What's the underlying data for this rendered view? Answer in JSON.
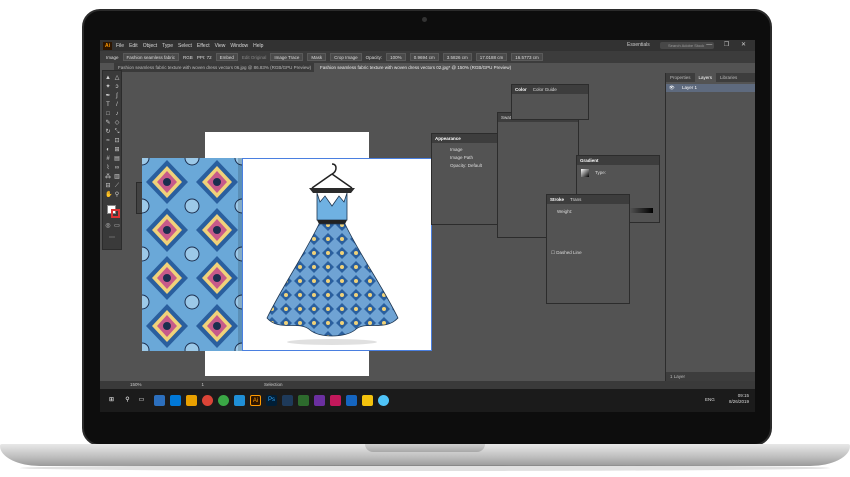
{
  "app": {
    "logo": "Ai",
    "menu": [
      "File",
      "Edit",
      "Object",
      "Type",
      "Select",
      "Effect",
      "View",
      "Window",
      "Help"
    ],
    "workspace": "Essentials",
    "search_placeholder": "Search Adobe Stock",
    "window_controls": "— ❐ ✕"
  },
  "control_bar": {
    "selection_type": "Image",
    "filename": "Fashion seamless fabric",
    "color_mode": "RGB",
    "ppi": "PPI: 72",
    "embed": "Embed",
    "edit_original": "Edit Original",
    "image_trace": "Image Trace",
    "mask": "Mask",
    "crop_image": "Crop Image",
    "opacity_label": "Opacity:",
    "opacity_value": "100%",
    "x": "0.9694 cm",
    "y": "3.5826 cm",
    "w": "17.0188 cm",
    "h": "16.5773 cm"
  },
  "tabs": [
    {
      "label": "Fashion seamless fabric texture with woven dress vectors 06.jpg @ 86.83% (RGB/GPU Preview)",
      "active": false
    },
    {
      "label": "Fashion seamless fabric texture with woven dress vectors 02.jpg* @ 150% (RGB/GPU Preview)",
      "active": true
    }
  ],
  "flyout": [
    "Transform",
    "Align",
    "Pathfinder"
  ],
  "panels": {
    "color": {
      "tabs": [
        "Color",
        "Color Guide"
      ]
    },
    "swatches": {
      "tabs": [
        "Swatches",
        "Brushes",
        "Symbols"
      ]
    },
    "appearance": {
      "title": "Appearance",
      "rows": [
        "Image",
        "Image Path",
        "Opacity: Default"
      ]
    },
    "gradient": {
      "title": "Gradient",
      "type_label": "Type:"
    },
    "stroke": {
      "tabs": [
        "Stroke",
        "Trans"
      ],
      "weight_label": "Weight:"
    },
    "dashed": {
      "label": "Dashed Line"
    }
  },
  "right_dock": {
    "tabs": [
      "Properties",
      "Layers",
      "Libraries"
    ],
    "layer_name": "Layer 1",
    "footer": "1 Layer"
  },
  "status": {
    "zoom": "150%",
    "page": "1",
    "tool": "Selection"
  },
  "taskbar": {
    "language": "ENG",
    "time": "09:15",
    "date": "8/26/2019"
  }
}
